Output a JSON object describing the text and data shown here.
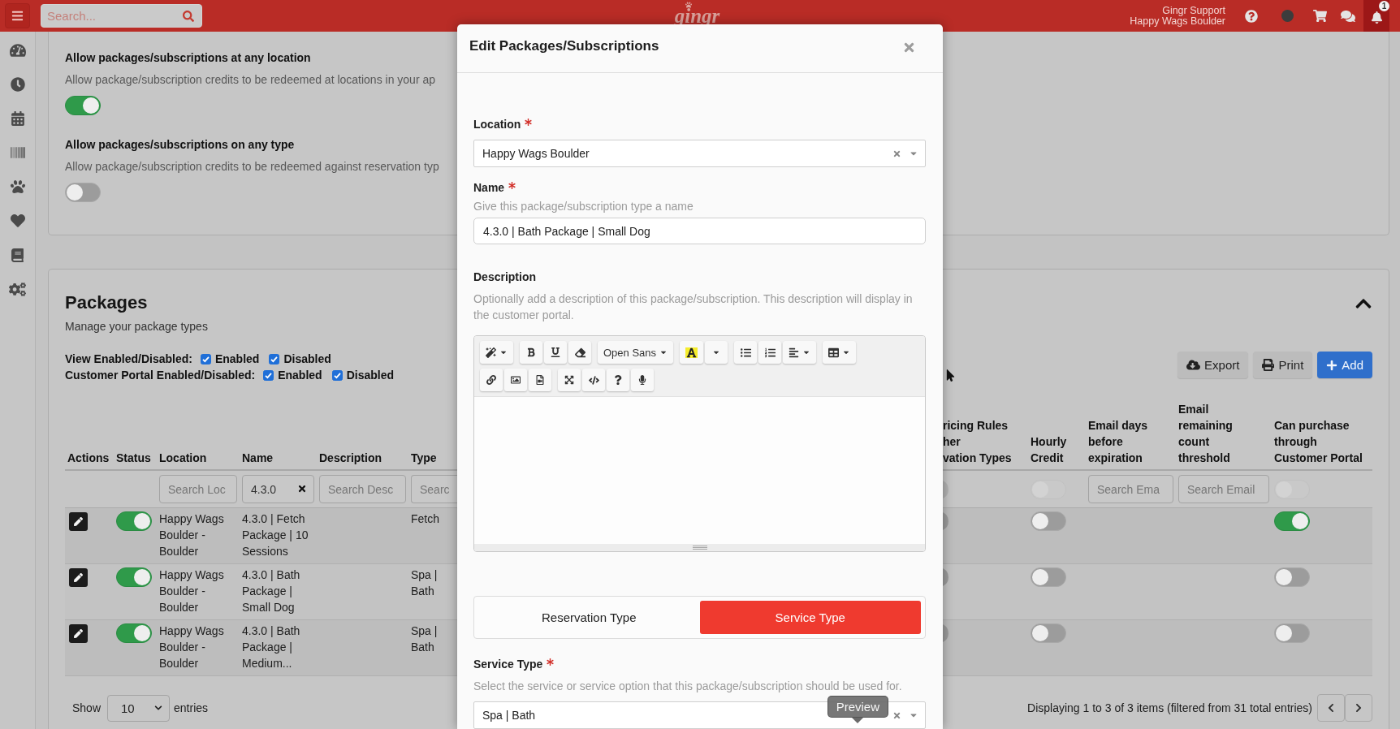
{
  "top_bar": {
    "search": {
      "placeholder": "Search..."
    },
    "logo": "gingr",
    "user_name": "Gingr Support",
    "user_location": "Happy Wags Boulder",
    "notification_count": "1"
  },
  "settings": [
    {
      "title": "Allow packages/subscriptions at any location",
      "description": "Allow package/subscription credits to be redeemed at locations in your ap",
      "on": true
    },
    {
      "title": "Allow packages/subscriptions on any type",
      "description": "Allow package/subscription credits to be redeemed against reservation typ",
      "on": false
    }
  ],
  "packages": {
    "title": "Packages",
    "subtitle": "Manage your package types",
    "expanded": true,
    "view_filters": [
      {
        "label": "View Enabled/Disabled:",
        "options": [
          {
            "label": "Enabled",
            "checked": true
          },
          {
            "label": "Disabled",
            "checked": true
          }
        ]
      },
      {
        "label": "Customer Portal Enabled/Disabled:",
        "options": [
          {
            "label": "Enabled",
            "checked": true
          },
          {
            "label": "Disabled",
            "checked": true
          }
        ]
      }
    ],
    "actions": [
      {
        "kind": "export",
        "label": "Export"
      },
      {
        "kind": "print",
        "label": "Print"
      },
      {
        "kind": "add",
        "label": "Add"
      }
    ],
    "table": {
      "columns": [
        {
          "kind": "actions",
          "label": "Actions"
        },
        {
          "kind": "switch",
          "label": "Status"
        },
        {
          "kind": "text",
          "label": "Location",
          "filter": {
            "kind": "input",
            "placeholder": "Search Loc"
          }
        },
        {
          "kind": "text",
          "label": "Name",
          "filter": {
            "kind": "input",
            "value": "4.3.0",
            "clearable": true
          }
        },
        {
          "kind": "text",
          "label": "Description",
          "filter": {
            "kind": "input",
            "placeholder": "Search Desc"
          }
        },
        {
          "kind": "text",
          "label": "Type",
          "filter": {
            "kind": "input",
            "placeholder": "Searc"
          }
        },
        {
          "kind": "partial",
          "label": "ricing Rules\nher\nvation Types",
          "filter": {
            "kind": "switch",
            "on": false,
            "disabled": true
          }
        },
        {
          "kind": "switch",
          "label": "Hourly Credit",
          "filter": {
            "kind": "switch",
            "on": false,
            "disabled": true
          }
        },
        {
          "kind": "text",
          "label": "Email days before expiration",
          "filter": {
            "kind": "input",
            "placeholder": "Search Ema"
          }
        },
        {
          "kind": "text",
          "label": "Email remaining count threshold",
          "filter": {
            "kind": "input",
            "placeholder": "Search Email"
          }
        },
        {
          "kind": "switch",
          "label": "Can purchase through Customer Portal",
          "filter": {
            "kind": "switch",
            "on": false,
            "disabled": true
          }
        }
      ],
      "rows": [
        {
          "status": true,
          "location": "Happy Wags Boulder - Boulder",
          "name": "4.3.0 | Fetch Package | 10 Sessions",
          "type": "Fetch",
          "partial_on": false,
          "hourly_credit": false,
          "portal_purchase": true
        },
        {
          "status": true,
          "location": "Happy Wags Boulder - Boulder",
          "name": "4.3.0 | Bath Package | Small Dog",
          "type": "Spa | Bath",
          "partial_on": false,
          "hourly_credit": false,
          "portal_purchase": false
        },
        {
          "status": true,
          "location": "Happy Wags Boulder - Boulder",
          "name": "4.3.0 | Bath Package | Medium...",
          "type": "Spa | Bath",
          "partial_on": false,
          "hourly_credit": false,
          "portal_purchase": false
        }
      ]
    },
    "footer": {
      "show_label": "Show",
      "page_size": "10",
      "entries_label": "entries",
      "info": "Displaying 1 to 3 of 3 items (filtered from 31 total entries)"
    }
  },
  "dialog": {
    "title": "Edit Packages/Subscriptions",
    "fields": [
      {
        "kind": "select",
        "label": "Location",
        "required": true,
        "value": "Happy Wags Boulder",
        "clearable": true
      },
      {
        "kind": "input",
        "label": "Name",
        "required": true,
        "hint": "Give this package/subscription type a name",
        "value": "4.3.0 | Bath Package | Small Dog"
      },
      {
        "kind": "editor",
        "label": "Description",
        "required": false,
        "hint": "Optionally add a description of this package/subscription. This description will display in the customer portal.",
        "font": "Open Sans"
      },
      {
        "kind": "segmented",
        "options": [
          {
            "label": "Reservation Type",
            "selected": false
          },
          {
            "label": "Service Type",
            "selected": true
          }
        ]
      },
      {
        "kind": "select",
        "label": "Service Type",
        "required": true,
        "hint": "Select the service or service option that this package/subscription should be used for.",
        "value": "Spa | Bath",
        "clearable": true,
        "tooltip": "Preview"
      }
    ]
  }
}
